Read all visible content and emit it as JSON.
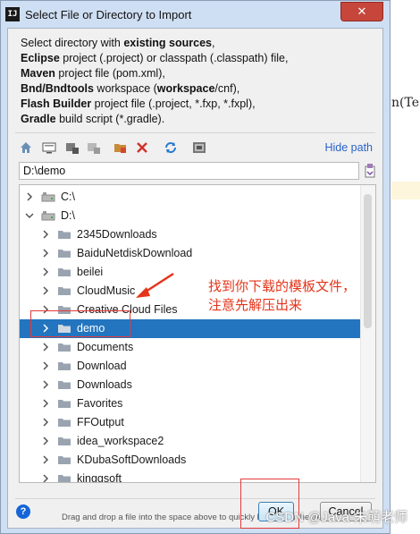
{
  "window": {
    "logo_text": "IJ",
    "title": "Select File or Directory to Import",
    "close_glyph": "✕"
  },
  "description": {
    "lines": [
      [
        {
          "t": "Select directory with ",
          "b": false
        },
        {
          "t": "existing sources",
          "b": true
        },
        {
          "t": ",",
          "b": false
        }
      ],
      [
        {
          "t": "Eclipse",
          "b": true
        },
        {
          "t": " project (.project) or classpath (.classpath) file,",
          "b": false
        }
      ],
      [
        {
          "t": "Maven",
          "b": true
        },
        {
          "t": " project file (pom.xml),",
          "b": false
        }
      ],
      [
        {
          "t": "Bnd/Bndtools",
          "b": true
        },
        {
          "t": " workspace (",
          "b": false
        },
        {
          "t": "workspace",
          "b": true
        },
        {
          "t": "/cnf),",
          "b": false
        }
      ],
      [
        {
          "t": "Flash Builder",
          "b": true
        },
        {
          "t": " project file (.project, *.fxp, *.fxpl),",
          "b": false
        }
      ],
      [
        {
          "t": "Gradle",
          "b": true
        },
        {
          "t": " build script (*.gradle).",
          "b": false
        }
      ]
    ]
  },
  "toolbar": {
    "icons": [
      "home-icon",
      "desktop-icon",
      "new-folder-icon",
      "project-icon",
      "module-folder-icon",
      "delete-icon",
      "refresh-icon",
      "show-hidden-icon"
    ],
    "hide_path_label": "Hide path"
  },
  "path_field": {
    "value": "D:\\demo"
  },
  "tree": {
    "rows": [
      {
        "label": "C:\\",
        "level": 0,
        "expanded": false,
        "type": "drive",
        "selected": false
      },
      {
        "label": "D:\\",
        "level": 0,
        "expanded": true,
        "type": "drive",
        "selected": false
      },
      {
        "label": "2345Downloads",
        "level": 1,
        "expanded": false,
        "type": "folder",
        "selected": false
      },
      {
        "label": "BaiduNetdiskDownload",
        "level": 1,
        "expanded": false,
        "type": "folder",
        "selected": false
      },
      {
        "label": "beilei",
        "level": 1,
        "expanded": false,
        "type": "folder",
        "selected": false
      },
      {
        "label": "CloudMusic",
        "level": 1,
        "expanded": false,
        "type": "folder",
        "selected": false
      },
      {
        "label": "Creative Cloud Files",
        "level": 1,
        "expanded": false,
        "type": "folder",
        "selected": false
      },
      {
        "label": "demo",
        "level": 1,
        "expanded": false,
        "type": "folder",
        "selected": true
      },
      {
        "label": "Documents",
        "level": 1,
        "expanded": false,
        "type": "folder",
        "selected": false
      },
      {
        "label": "Download",
        "level": 1,
        "expanded": false,
        "type": "folder",
        "selected": false
      },
      {
        "label": "Downloads",
        "level": 1,
        "expanded": false,
        "type": "folder",
        "selected": false
      },
      {
        "label": "Favorites",
        "level": 1,
        "expanded": false,
        "type": "folder",
        "selected": false
      },
      {
        "label": "FFOutput",
        "level": 1,
        "expanded": false,
        "type": "folder",
        "selected": false
      },
      {
        "label": "idea_workspace2",
        "level": 1,
        "expanded": false,
        "type": "folder",
        "selected": false
      },
      {
        "label": "KDubaSoftDownloads",
        "level": 1,
        "expanded": false,
        "type": "folder",
        "selected": false
      },
      {
        "label": "kinggsoft",
        "level": 1,
        "expanded": false,
        "type": "folder",
        "selected": false
      }
    ]
  },
  "annotation": {
    "line1": "找到你下载的模板文件，",
    "line2": "注意先解压出来",
    "color": "#e5341a"
  },
  "hint": "Drag and drop a file into the space above to quickly locate it in the tree",
  "footer": {
    "help_glyph": "?",
    "ok_label": "OK",
    "cancel_label": "Cancel"
  },
  "watermark": "CSDN @Java-朱萌老师",
  "background_fragment": "n(Te",
  "colors": {
    "selection": "#2375bf",
    "link": "#2962c9",
    "annotation_red": "#e63a3a"
  }
}
